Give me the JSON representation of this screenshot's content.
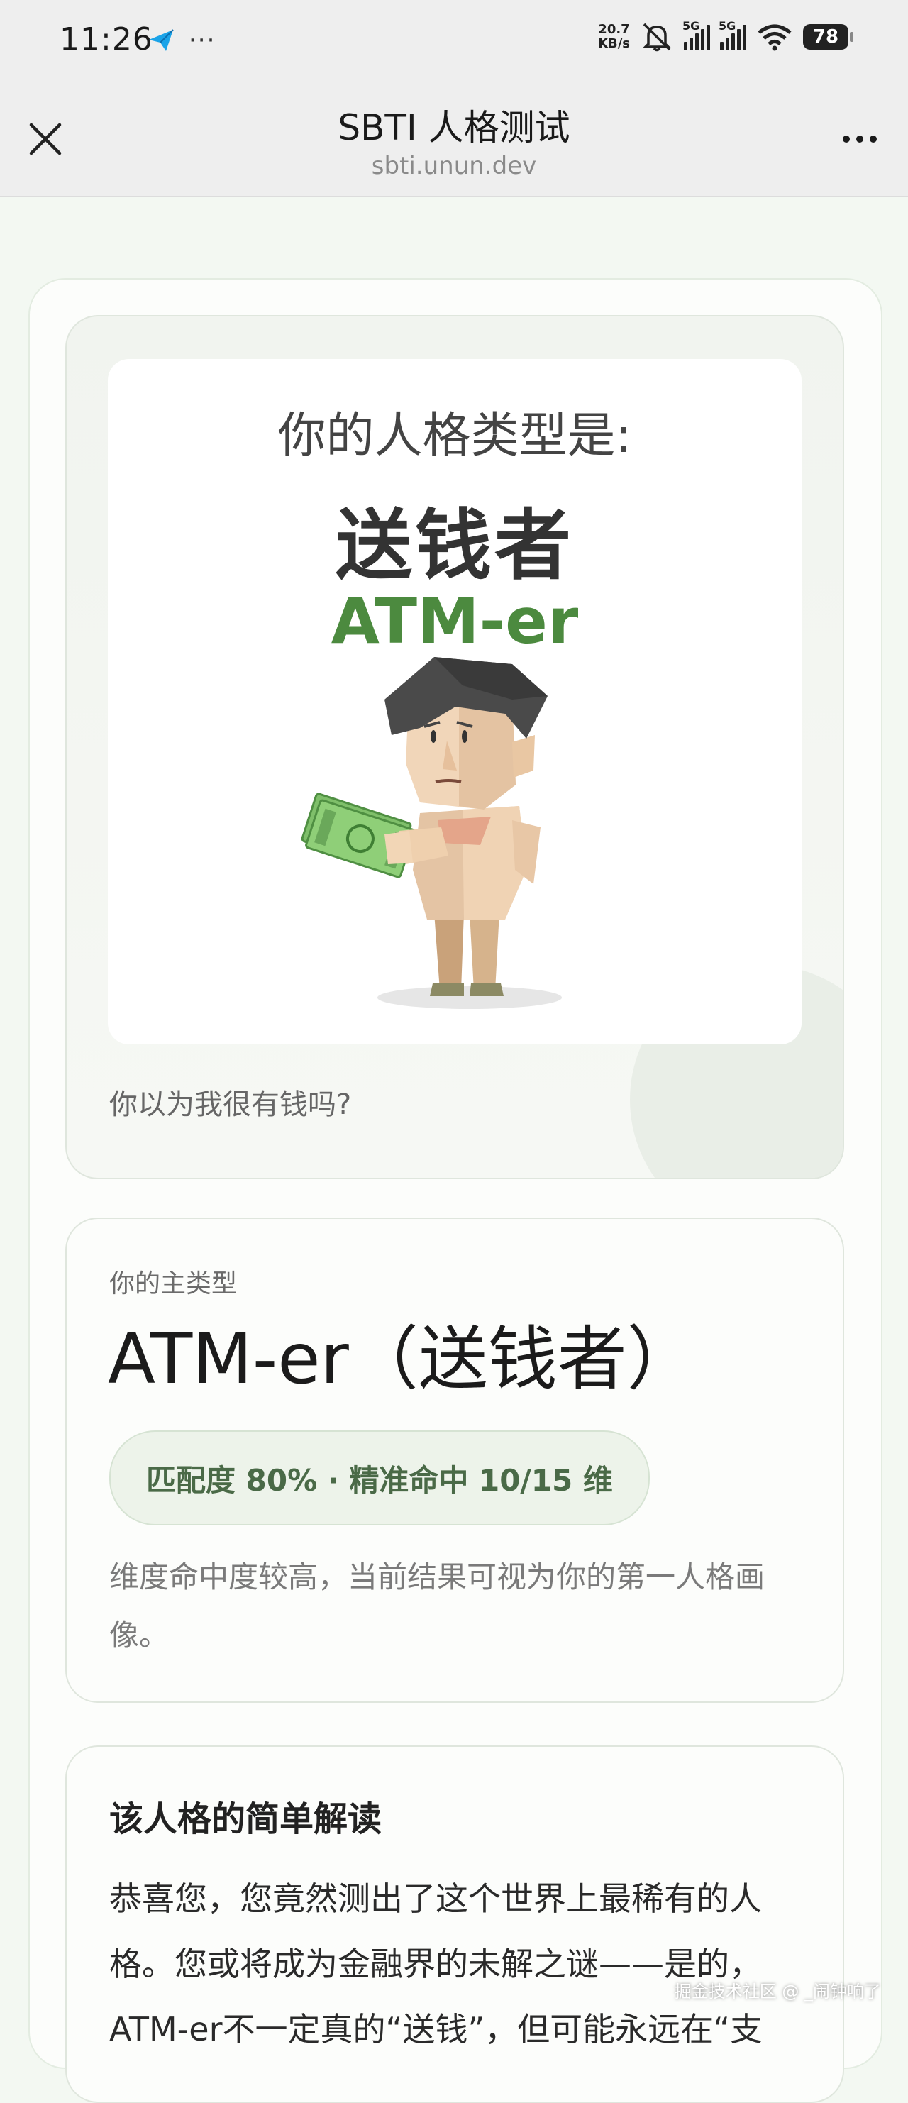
{
  "status_bar": {
    "time": "11:26",
    "speed_value": "20.7",
    "speed_unit": "KB/s",
    "network_1": "5G",
    "network_2": "5G",
    "battery": "78"
  },
  "header": {
    "title": "SBTI 人格测试",
    "domain": "sbti.unun.dev"
  },
  "hero": {
    "intro": "你的人格类型是:",
    "type_cn": "送钱者",
    "type_en": "ATM-er",
    "quote": "你以为我很有钱吗?"
  },
  "main_type": {
    "label": "你的主类型",
    "title": "ATM-er（送钱者）",
    "match": "匹配度 80% · 精准命中 10/15 维",
    "match_percent": 80,
    "desc": "维度命中度较高，当前结果可视为你的第一人格画像。"
  },
  "reading": {
    "title": "该人格的简单解读",
    "body": "恭喜您，您竟然测出了这个世界上最稀有的人格。您或将成为金融界的未解之谜——是的，ATM-er不一定真的“送钱”，但可能永远在“支"
  },
  "watermark": "掘金技术社区 @ _闹钟响了",
  "colors": {
    "accent_green": "#4c8a3f",
    "pill_bg": "#edf3ea"
  }
}
